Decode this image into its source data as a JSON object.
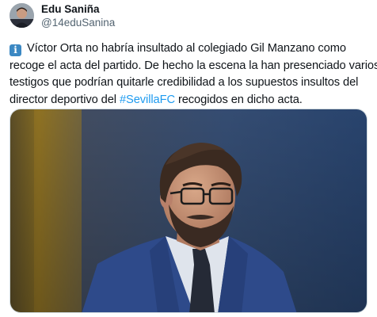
{
  "author": {
    "name": "Edu Saniña",
    "handle": "@14eduSanina",
    "avatar_icon": "profile-photo"
  },
  "tweet": {
    "emoji_icon": "information-emoji",
    "emoji_glyph": "i",
    "lines": [
      "Víctor Orta no habría insultado al colegiado Gil Manzano como",
      "recoge el acta del partido. De hecho la escena la han presenciado varios",
      "testigos que podrían quitarle credibilidad a los supuestos insultos del"
    ],
    "last_line_prefix": "director deportivo del ",
    "hashtag": "#SevillaFC",
    "last_line_suffix": " recogidos en dicho acta."
  },
  "media": {
    "description_icon": "man-in-suit-photo"
  },
  "colors": {
    "hashtag": "#1d9bf0",
    "handle": "#536471",
    "text": "#0f1419",
    "info_emoji_bg": "#3b88c3"
  }
}
